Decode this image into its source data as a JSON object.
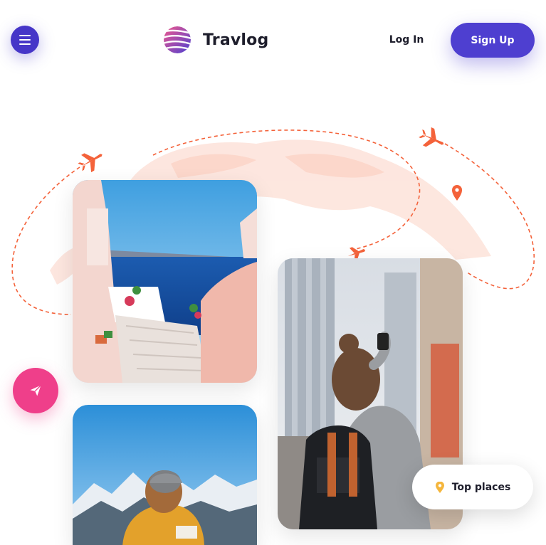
{
  "header": {
    "brand_name": "Travlog",
    "login_label": "Log In",
    "signup_label": "Sign Up",
    "icons": {
      "menu": "menu-icon",
      "logo": "travlog-logo-icon"
    }
  },
  "hero": {
    "top_places_label": "Top places",
    "icons": {
      "send": "send-icon",
      "pin": "map-pin-icon",
      "airplanes": [
        "airplane-icon",
        "airplane-icon",
        "airplane-icon"
      ]
    },
    "photos": [
      "santorini-photo",
      "city-traveler-photo",
      "mountain-traveler-photo"
    ]
  },
  "colors": {
    "primary": "#4e3fd0",
    "accent_pink": "#ef3f8a",
    "route_orange": "#f4623a",
    "map_tint": "#fde4dc",
    "text_dark": "#1d1d2b",
    "pin_yellow": "#f5b63c"
  }
}
